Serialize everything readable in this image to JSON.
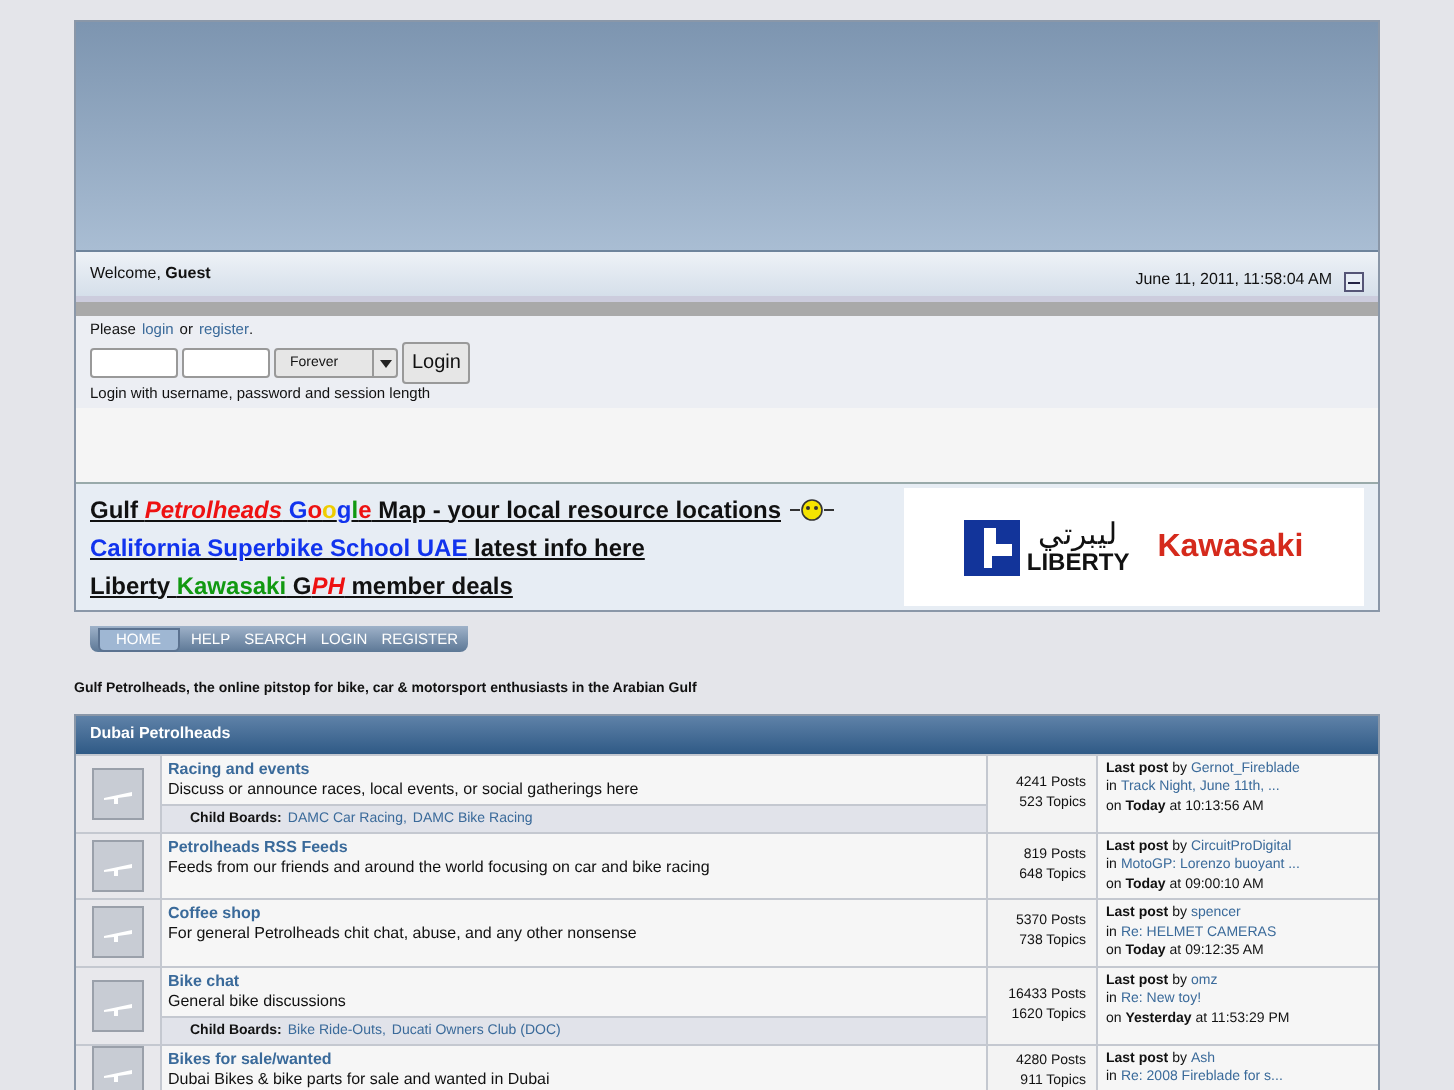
{
  "welcome": {
    "text": "Welcome, **Guest**",
    "datetime": "June 11, 2011, 11:58:04 AM"
  },
  "login": {
    "prompt_before": "Please",
    "login_link": "login",
    "or_word": "or",
    "register_link": "register",
    "prompt_after": ".",
    "duration": "Forever",
    "button": "Login",
    "hint": "Login with username, password and session length"
  },
  "ad_lines": [
    [
      {
        "text": "Gulf ",
        "color": "#111111",
        "italic": false
      },
      {
        "text": "Petrolheads",
        "color": "#ee1111",
        "italic": true
      },
      {
        "text": " G",
        "color": "#1133ee",
        "italic": false
      },
      {
        "text": "o",
        "color": "#ee1111",
        "italic": false
      },
      {
        "text": "o",
        "color": "#eecc00",
        "italic": false
      },
      {
        "text": "g",
        "color": "#1133ee",
        "italic": false
      },
      {
        "text": "l",
        "color": "#119911",
        "italic": false
      },
      {
        "text": "e",
        "color": "#ee1111",
        "italic": false
      },
      {
        "text": " Map - your local resource locations",
        "color": "#111111",
        "italic": false
      }
    ],
    [
      {
        "text": "California Superbike School UAE",
        "color": "#1133ee",
        "italic": false
      },
      {
        "text": " latest info here",
        "color": "#111111",
        "italic": false
      }
    ],
    [
      {
        "text": "Liberty ",
        "color": "#111111",
        "italic": false
      },
      {
        "text": "Kawasaki",
        "color": "#119911",
        "italic": false
      },
      {
        "text": " G",
        "color": "#111111",
        "italic": false
      },
      {
        "text": "PH",
        "color": "#ee1111",
        "italic": true
      },
      {
        "text": " member deals",
        "color": "#111111",
        "italic": false
      }
    ]
  ],
  "sponsor": {
    "arabic": "ليبرتي",
    "liberty": "LIBERTY",
    "kawasaki": "Kawasaki"
  },
  "menu": [
    {
      "label": "HOME",
      "selected": true
    },
    {
      "label": "HELP",
      "selected": false
    },
    {
      "label": "SEARCH",
      "selected": false
    },
    {
      "label": "LOGIN",
      "selected": false
    },
    {
      "label": "REGISTER",
      "selected": false
    }
  ],
  "tagline": "Gulf Petrolheads, the online pitstop for bike, car & motorsport enthusiasts in the Arabian Gulf",
  "category": "Dubai Petrolheads",
  "boards": [
    {
      "title": "Racing and events",
      "description": "Discuss or announce races, local events, or social gatherings here",
      "child_label": "Child Boards:",
      "children": [
        "DAMC Car Racing,",
        "DAMC Bike Racing"
      ],
      "posts": "4241 Posts",
      "topics": "523 Topics",
      "last_prefix": "**Last post** by",
      "user": "Gernot_Fireblade",
      "in_word": "in",
      "topic": "Track Night, June 11th, ...",
      "when": "on **Today** at 10:13:56 AM"
    },
    {
      "title": "Petrolheads RSS Feeds",
      "description": "Feeds from our friends and around the world focusing on car and bike racing",
      "posts": "819 Posts",
      "topics": "648 Topics",
      "last_prefix": "**Last post** by",
      "user": "CircuitProDigital",
      "in_word": "in",
      "topic": "MotoGP: Lorenzo buoyant ...",
      "when": "on **Today** at 09:00:10 AM"
    },
    {
      "title": "Coffee shop",
      "description": "For general Petrolheads chit chat, abuse, and any other nonsense",
      "posts": "5370 Posts",
      "topics": "738 Topics",
      "last_prefix": "**Last post** by",
      "user": "spencer",
      "in_word": "in",
      "topic": "Re: HELMET CAMERAS",
      "when": "on **Today** at 09:12:35 AM"
    },
    {
      "title": "Bike chat",
      "description": "General bike discussions",
      "child_label": "Child Boards:",
      "children": [
        "Bike Ride-Outs,",
        "Ducati Owners Club (DOC)"
      ],
      "posts": "16433 Posts",
      "topics": "1620 Topics",
      "last_prefix": "**Last post** by",
      "user": "omz",
      "in_word": "in",
      "topic": "Re: New toy!",
      "when": "on **Yesterday** at 11:53:29 PM"
    },
    {
      "title": "Bikes for sale/wanted",
      "description": "Dubai Bikes & bike parts for sale and wanted in Dubai",
      "posts": "4280 Posts",
      "topics": "911 Topics",
      "last_prefix": "**Last post** by",
      "user": "Ash",
      "in_word": "in",
      "topic": "Re: 2008 Fireblade for s..."
    }
  ]
}
